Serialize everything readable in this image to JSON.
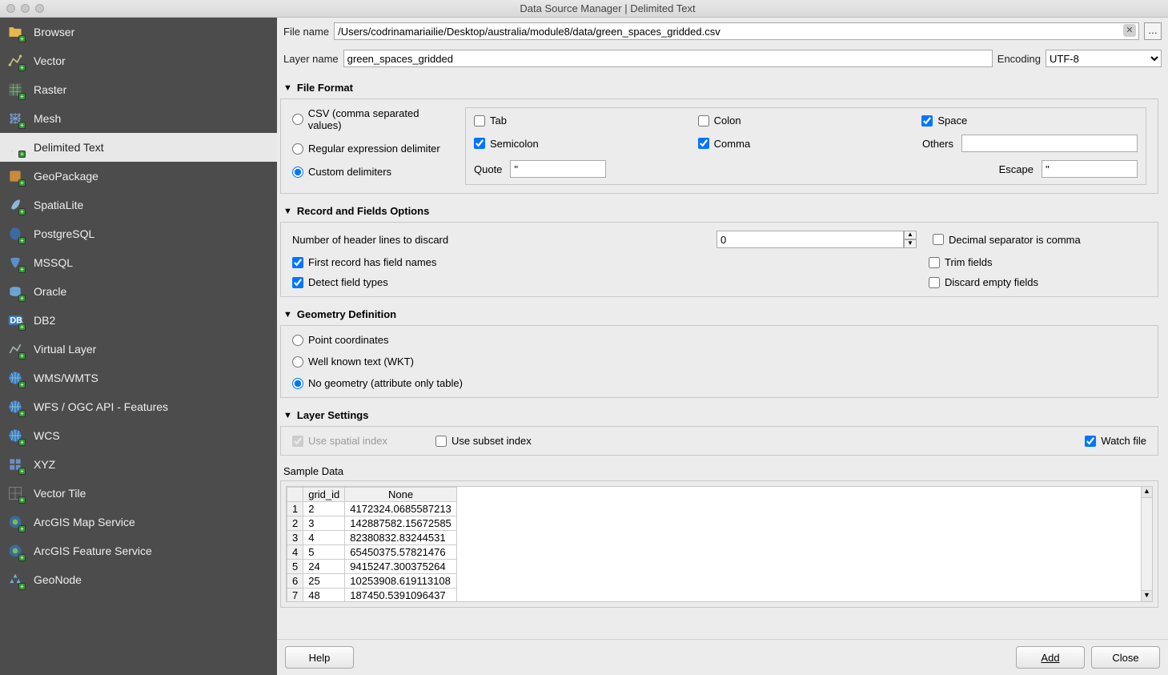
{
  "window": {
    "title": "Data Source Manager | Delimited Text"
  },
  "sidebar": {
    "items": [
      {
        "label": "Browser",
        "icon": "folder"
      },
      {
        "label": "Vector",
        "icon": "vect"
      },
      {
        "label": "Raster",
        "icon": "grid"
      },
      {
        "label": "Mesh",
        "icon": "mesh"
      },
      {
        "label": "Delimited Text",
        "icon": "comma",
        "selected": true
      },
      {
        "label": "GeoPackage",
        "icon": "gpkg"
      },
      {
        "label": "SpatiaLite",
        "icon": "feather"
      },
      {
        "label": "PostgreSQL",
        "icon": "pg"
      },
      {
        "label": "MSSQL",
        "icon": "mssql"
      },
      {
        "label": "Oracle",
        "icon": "oracle"
      },
      {
        "label": "DB2",
        "icon": "db2"
      },
      {
        "label": "Virtual Layer",
        "icon": "vl"
      },
      {
        "label": "WMS/WMTS",
        "icon": "globe"
      },
      {
        "label": "WFS / OGC API - Features",
        "icon": "globe"
      },
      {
        "label": "WCS",
        "icon": "globe"
      },
      {
        "label": "XYZ",
        "icon": "xyz"
      },
      {
        "label": "Vector Tile",
        "icon": "vtile"
      },
      {
        "label": "ArcGIS Map Service",
        "icon": "arcgis"
      },
      {
        "label": "ArcGIS Feature Service",
        "icon": "arcgis"
      },
      {
        "label": "GeoNode",
        "icon": "geonode"
      }
    ]
  },
  "top": {
    "file_label": "File name",
    "file_value": "/Users/codrinamariailie/Desktop/australia/module8/data/green_spaces_gridded.csv",
    "browse": "…",
    "layer_label": "Layer name",
    "layer_value": "green_spaces_gridded",
    "encoding_label": "Encoding",
    "encoding_value": "UTF-8"
  },
  "sections": {
    "file_format": {
      "title": "File Format",
      "radios": {
        "csv": "CSV (comma separated values)",
        "regex": "Regular expression delimiter",
        "custom": "Custom delimiters"
      },
      "selected": "custom",
      "delims": {
        "tab": "Tab",
        "colon": "Colon",
        "space": "Space",
        "semicolon": "Semicolon",
        "comma": "Comma",
        "others": "Others"
      },
      "checked": {
        "tab": false,
        "colon": false,
        "space": true,
        "semicolon": true,
        "comma": true
      },
      "others_value": "",
      "quote_label": "Quote",
      "quote_value": "\"",
      "escape_label": "Escape",
      "escape_value": "\""
    },
    "record": {
      "title": "Record and Fields Options",
      "header_lines_label": "Number of header lines to discard",
      "header_lines_value": "0",
      "first_record": "First record has field names",
      "detect_types": "Detect field types",
      "decimal_comma": "Decimal separator is comma",
      "trim": "Trim fields",
      "discard_empty": "Discard empty fields",
      "checked": {
        "first_record": true,
        "detect_types": true,
        "decimal_comma": false,
        "trim": false,
        "discard_empty": false
      }
    },
    "geometry": {
      "title": "Geometry Definition",
      "point": "Point coordinates",
      "wkt": "Well known text (WKT)",
      "none": "No geometry (attribute only table)",
      "selected": "none"
    },
    "layer": {
      "title": "Layer Settings",
      "spatial": "Use spatial index",
      "subset": "Use subset index",
      "watch": "Watch file",
      "checked": {
        "spatial": true,
        "subset": false,
        "watch": true
      }
    },
    "sample": {
      "title": "Sample Data",
      "headers": [
        "grid_id",
        "None"
      ],
      "rows": [
        [
          "1",
          "2",
          "4172324.0685587213"
        ],
        [
          "2",
          "3",
          "142887582.15672585"
        ],
        [
          "3",
          "4",
          "82380832.83244531"
        ],
        [
          "4",
          "5",
          "65450375.57821476"
        ],
        [
          "5",
          "24",
          "9415247.300375264"
        ],
        [
          "6",
          "25",
          "10253908.619113108"
        ],
        [
          "7",
          "48",
          "187450.5391096437"
        ]
      ]
    }
  },
  "footer": {
    "help": "Help",
    "add": "Add",
    "close": "Close"
  }
}
